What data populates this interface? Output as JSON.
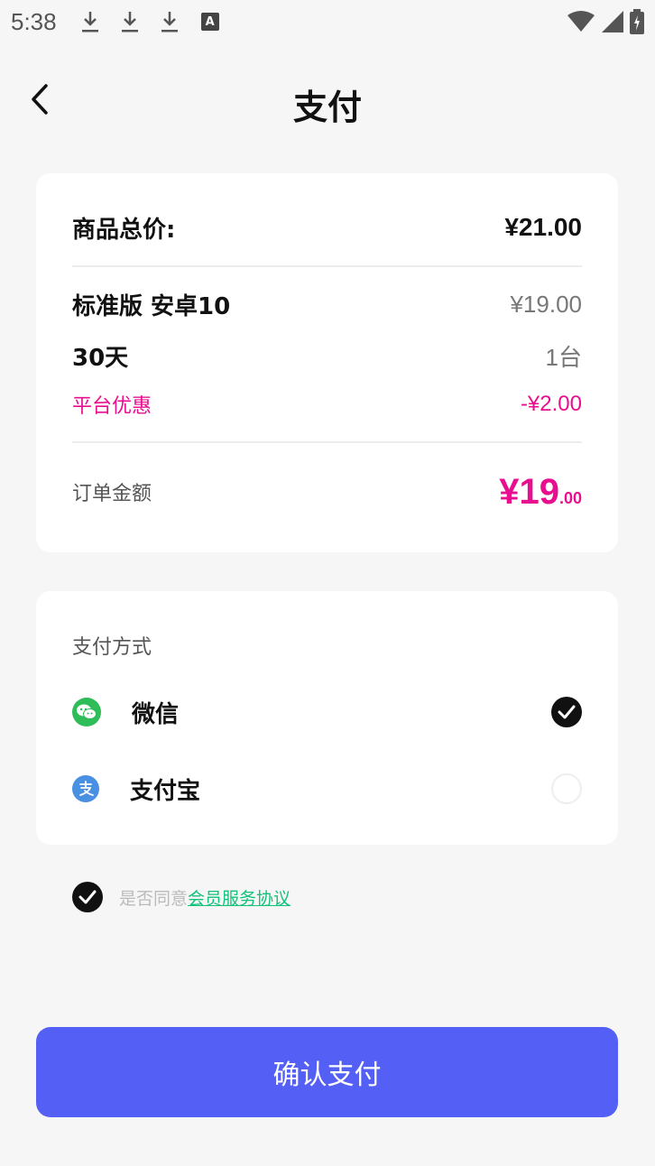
{
  "status_bar": {
    "time": "5:38",
    "status_a_label": "A"
  },
  "header": {
    "title": "支付"
  },
  "summary": {
    "total_label": "商品总价:",
    "total_value": "¥21.00",
    "product_name": "标准版 安卓10",
    "product_price": "¥19.00",
    "duration": "30天",
    "quantity": "1台",
    "discount_label": "平台优惠",
    "discount_value": "-¥2.00",
    "order_label": "订单金额",
    "order_value_main": "¥19",
    "order_value_cents": ".00"
  },
  "payment": {
    "title": "支付方式",
    "methods": [
      {
        "label": "微信",
        "icon": "wechat-icon",
        "selected": true
      },
      {
        "label": "支付宝",
        "icon": "alipay-icon",
        "selected": false
      }
    ]
  },
  "agreement": {
    "checked": true,
    "prefix": "是否同意",
    "link_text": "会员服务协议"
  },
  "confirm_button": {
    "label": "确认支付"
  },
  "colors": {
    "accent": "#535ff5",
    "price_pink": "#e80f8f",
    "link_green": "#13c27a",
    "wechat_green": "#2fbd5a",
    "alipay_blue": "#4a90e2"
  }
}
